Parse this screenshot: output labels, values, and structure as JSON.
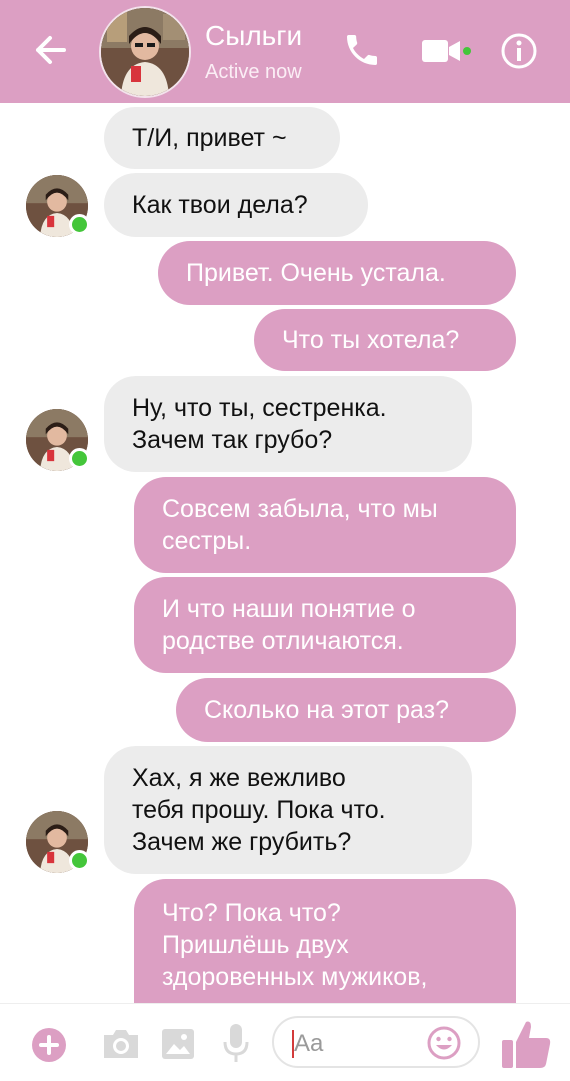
{
  "header": {
    "contact_name": "Сыльги",
    "status": "Active now"
  },
  "colors": {
    "accent": "#dc9fc3",
    "incoming_bubble": "#ececec",
    "online": "#44c63a"
  },
  "messages": [
    {
      "direction": "in",
      "text": "Т/И, привет ~"
    },
    {
      "direction": "in",
      "text": "Как твои дела?"
    },
    {
      "direction": "out",
      "text": "Привет. Очень устала."
    },
    {
      "direction": "out",
      "text": "Что ты хотела?"
    },
    {
      "direction": "in",
      "text": "Ну, что ты, сестренка.\nЗачем так грубо?"
    },
    {
      "direction": "out",
      "text": "Совсем забыла, что мы\nсестры."
    },
    {
      "direction": "out",
      "text": "И что наши понятие о\nродстве отличаются."
    },
    {
      "direction": "out",
      "text": "Сколько на этот раз?"
    },
    {
      "direction": "in",
      "text": "Хах, я же вежливо\nтебя прошу. Пока что.\nЗачем же грубить?"
    },
    {
      "direction": "out",
      "text": "Что? Пока что?\nПришлёшь двух\nздоровенных мужиков,"
    }
  ],
  "composer": {
    "placeholder": "Aa"
  },
  "icons": [
    "back-arrow-icon",
    "phone-icon",
    "video-camera-icon",
    "info-icon",
    "plus-icon",
    "camera-icon",
    "image-icon",
    "microphone-icon",
    "emoji-icon",
    "thumbs-up-icon"
  ]
}
